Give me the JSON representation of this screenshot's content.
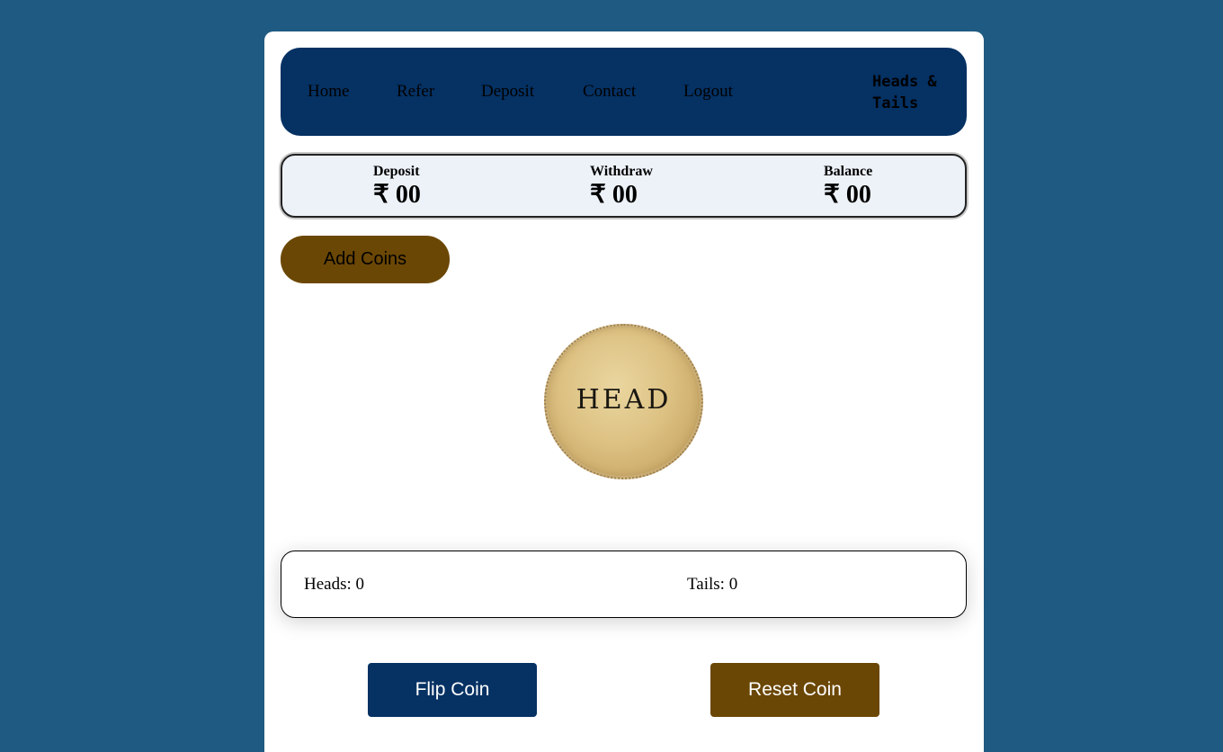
{
  "nav": {
    "links": [
      "Home",
      "Refer",
      "Deposit",
      "Contact",
      "Logout"
    ],
    "brand": "Heads & Tails"
  },
  "stats": {
    "deposit": {
      "label": "Deposit",
      "value": "₹ 00"
    },
    "withdraw": {
      "label": "Withdraw",
      "value": "₹ 00"
    },
    "balance": {
      "label": "Balance",
      "value": "₹ 00"
    }
  },
  "add_coins_label": "Add Coins",
  "coin": {
    "face": "HEAD"
  },
  "scoreboard": {
    "heads": "Heads: 0",
    "tails": "Tails: 0"
  },
  "actions": {
    "flip_label": "Flip Coin",
    "reset_label": "Reset Coin"
  },
  "colors": {
    "page_background": "#1f5a82",
    "navbar": "#053163",
    "brown_button": "#6b4705",
    "stats_background": "#edf2f9"
  }
}
